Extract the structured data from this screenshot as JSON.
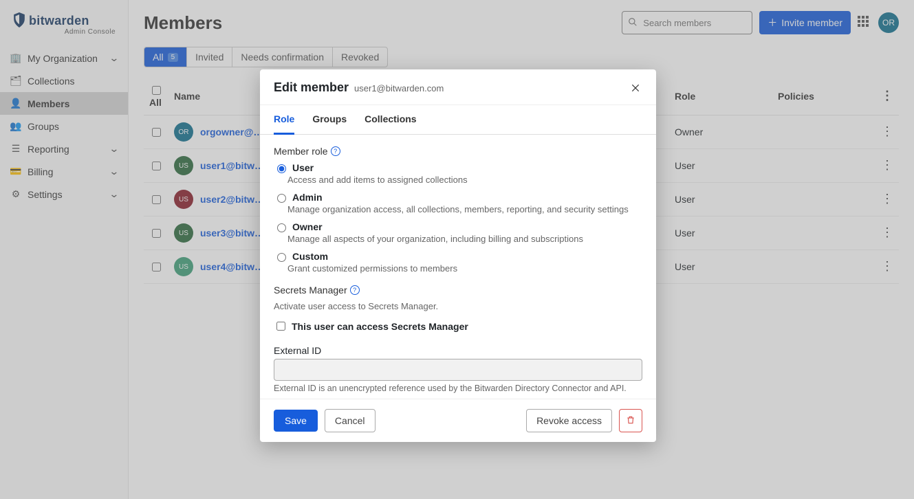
{
  "brand": {
    "name": "bitwarden",
    "subtitle": "Admin Console"
  },
  "sidebar": {
    "items": [
      {
        "label": "My Organization",
        "expandable": true
      },
      {
        "label": "Collections"
      },
      {
        "label": "Members",
        "active": true
      },
      {
        "label": "Groups"
      },
      {
        "label": "Reporting",
        "expandable": true
      },
      {
        "label": "Billing",
        "expandable": true
      },
      {
        "label": "Settings",
        "expandable": true
      }
    ]
  },
  "page": {
    "title": "Members"
  },
  "search": {
    "placeholder": "Search members"
  },
  "header": {
    "invite_label": "Invite member",
    "avatar": "OR"
  },
  "page_tabs": [
    {
      "label": "All",
      "badge": "5",
      "active": true
    },
    {
      "label": "Invited"
    },
    {
      "label": "Needs confirmation"
    },
    {
      "label": "Revoked"
    }
  ],
  "table": {
    "headers": {
      "check": "All",
      "name": "Name",
      "role": "Role",
      "policies": "Policies"
    },
    "rows": [
      {
        "name": "orgowner@…",
        "role": "Owner",
        "avatar": "OR",
        "color": "#11708f"
      },
      {
        "name": "user1@bitw…",
        "role": "User",
        "avatar": "US",
        "color": "#2d6a3e"
      },
      {
        "name": "user2@bitw…",
        "role": "User",
        "avatar": "US",
        "color": "#8a1f2b"
      },
      {
        "name": "user3@bitw…",
        "role": "User",
        "avatar": "US",
        "color": "#2d6a3e"
      },
      {
        "name": "user4@bitw…",
        "role": "User",
        "avatar": "US",
        "color": "#3fa07a"
      }
    ]
  },
  "dialog": {
    "title": "Edit member",
    "subtitle": "user1@bitwarden.com",
    "tabs": {
      "role": "Role",
      "groups": "Groups",
      "collections": "Collections"
    },
    "member_role_label": "Member role",
    "roles": {
      "user": {
        "label": "User",
        "desc": "Access and add items to assigned collections"
      },
      "admin": {
        "label": "Admin",
        "desc": "Manage organization access, all collections, members, reporting, and security settings"
      },
      "owner": {
        "label": "Owner",
        "desc": "Manage all aspects of your organization, including billing and subscriptions"
      },
      "custom": {
        "label": "Custom",
        "desc": "Grant customized permissions to members"
      }
    },
    "secrets": {
      "title": "Secrets Manager",
      "desc": "Activate user access to Secrets Manager.",
      "checkbox_label": "This user can access Secrets Manager"
    },
    "external_id": {
      "label": "External ID",
      "hint": "External ID is an unencrypted reference used by the Bitwarden Directory Connector and API."
    },
    "buttons": {
      "save": "Save",
      "cancel": "Cancel",
      "revoke": "Revoke access"
    }
  }
}
